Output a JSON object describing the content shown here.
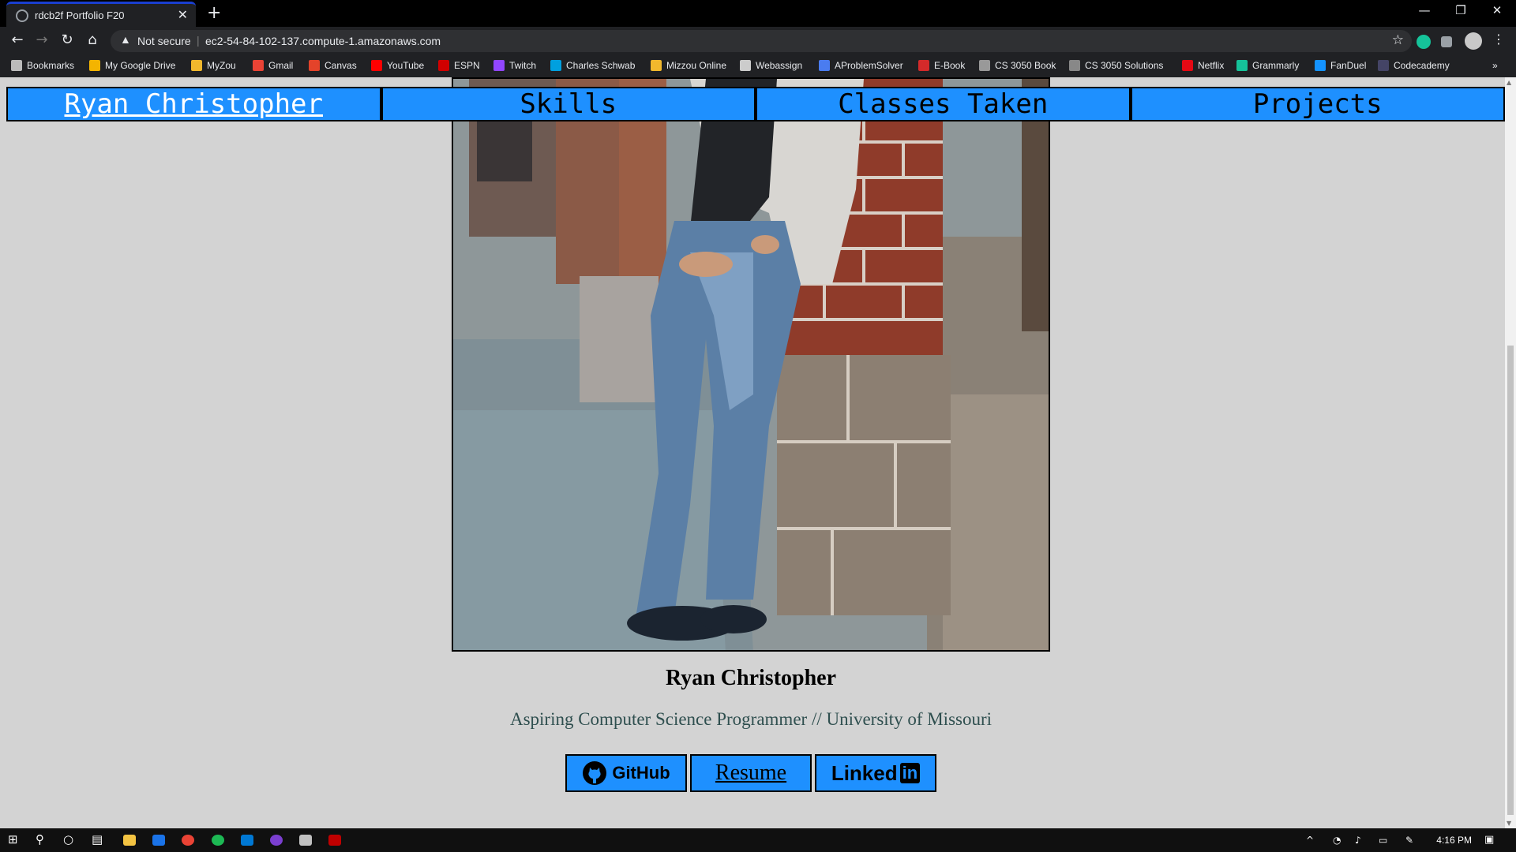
{
  "browser": {
    "tab_title": "rdcb2f Portfolio F20",
    "tab_close": "✕",
    "new_tab": "+",
    "not_secure": "Not secure",
    "url": "ec2-54-84-102-137.compute-1.amazonaws.com",
    "window_controls": [
      "—",
      "❐",
      "✕"
    ]
  },
  "bookmarks": [
    {
      "label": "Bookmarks",
      "icon": "star-icon",
      "color": "#bbbbbb"
    },
    {
      "label": "My Google Drive",
      "icon": "drive-icon",
      "color": "#f4b400"
    },
    {
      "label": "MyZou",
      "icon": "myzou-icon",
      "color": "#f1b82d"
    },
    {
      "label": "Gmail",
      "icon": "gmail-icon",
      "color": "#ea4335"
    },
    {
      "label": "Canvas",
      "icon": "canvas-icon",
      "color": "#e4432a"
    },
    {
      "label": "YouTube",
      "icon": "youtube-icon",
      "color": "#ff0000"
    },
    {
      "label": "ESPN",
      "icon": "espn-icon",
      "color": "#d00000"
    },
    {
      "label": "Twitch",
      "icon": "twitch-icon",
      "color": "#9146ff"
    },
    {
      "label": "Charles Schwab",
      "icon": "schwab-icon",
      "color": "#00a0df"
    },
    {
      "label": "Mizzou Online",
      "icon": "mizzou-icon",
      "color": "#f1b82d"
    },
    {
      "label": "Webassign",
      "icon": "webassign-icon",
      "color": "#cccccc"
    },
    {
      "label": "AProblemSolver",
      "icon": "aproblemsolver-icon",
      "color": "#4a7cf0"
    },
    {
      "label": "E-Book",
      "icon": "ebook-icon",
      "color": "#d42a2a"
    },
    {
      "label": "CS 3050 Book",
      "icon": "globe-icon",
      "color": "#999999"
    },
    {
      "label": "CS 3050 Solutions",
      "icon": "wikidot-icon",
      "color": "#888888"
    },
    {
      "label": "Netflix",
      "icon": "netflix-icon",
      "color": "#e50914"
    },
    {
      "label": "Grammarly",
      "icon": "grammarly-icon",
      "color": "#15c39a"
    },
    {
      "label": "FanDuel",
      "icon": "fanduel-icon",
      "color": "#1493ff"
    },
    {
      "label": "Codecademy",
      "icon": "codecademy-icon",
      "color": "#444466"
    }
  ],
  "nav": {
    "items": [
      "Ryan Christopher",
      "Skills",
      "Classes Taken",
      "Projects"
    ]
  },
  "profile": {
    "name": "Ryan Christopher",
    "subtitle": "Aspiring Computer Science Programmer // University of Missouri"
  },
  "links": {
    "github": "GitHub",
    "resume": "Resume",
    "linkedin_a": "Linked",
    "linkedin_b": "in"
  },
  "taskbar": {
    "time": "4:16 PM"
  },
  "colors": {
    "accent": "#1e90ff",
    "page_bg": "#d3d3d3",
    "subtitle": "#2f4f4f"
  }
}
